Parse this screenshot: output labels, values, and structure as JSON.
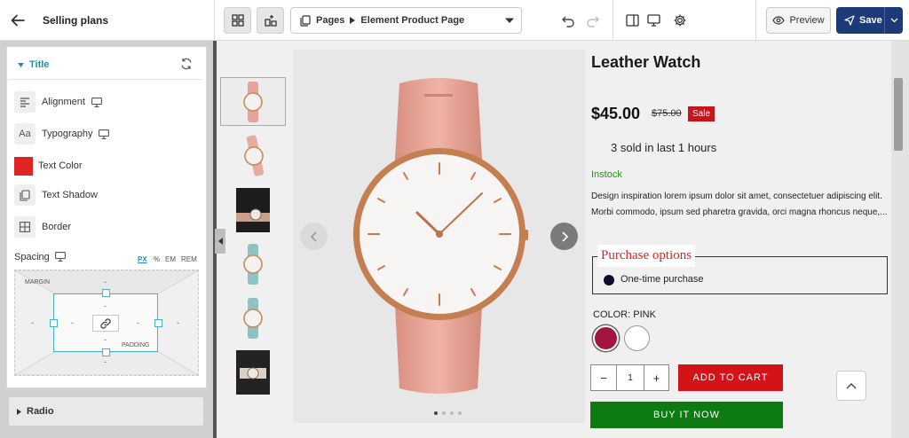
{
  "topbar": {
    "back_icon": "arrow-left-icon",
    "panel_title": "Selling plans",
    "pages_select": {
      "root": "Pages",
      "current": "Element Product Page"
    },
    "preview_label": "Preview",
    "save_label": "Save"
  },
  "settings": {
    "section_title": "Title",
    "properties": [
      {
        "label": "Alignment",
        "icon": "align-left-icon"
      },
      {
        "label": "Typography",
        "icon": "typography-icon",
        "glyph": "Aa"
      },
      {
        "label": "Text Color",
        "icon": "color-swatch",
        "color": "#e02424"
      },
      {
        "label": "Text Shadow",
        "icon": "copy-icon"
      },
      {
        "label": "Border",
        "icon": "border-grid-icon"
      }
    ],
    "spacing": {
      "label": "Spacing",
      "units": [
        "PX",
        "%",
        "EM",
        "REM"
      ],
      "active_unit": "PX",
      "margin_label": "MARGIN",
      "padding_label": "PADDING",
      "empty_value": "-"
    },
    "collapsed_section": "Radio"
  },
  "product": {
    "title": "Leather Watch",
    "price": "$45.00",
    "compare_price": "$75.00",
    "sale_badge": "Sale",
    "sold_text": "3 sold in last 1 hours",
    "stock": "Instock",
    "description": "Design inspiration lorem ipsum dolor sit amet, consectetuer adipiscing elit. Morbi commodo, ipsum sed pharetra gravida, orci magna rhoncus neque,...",
    "purchase_options_label": "Purchase options",
    "purchase_option": "One-time purchase",
    "color_label": "COLOR:",
    "color_value": "PINK",
    "swatches": [
      "#a3143e",
      "#ffffff"
    ],
    "qty_minus": "−",
    "qty_value": "1",
    "qty_plus": "+",
    "add_to_cart": "ADD TO CART",
    "buy_now": "BUY IT NOW"
  },
  "colors": {
    "accent": "#1f8fb8",
    "save_button": "#1d3a78",
    "sale": "#c4161c",
    "add_to_cart": "#d41319",
    "buy_now": "#0d7a12",
    "stock": "#2d8b1d",
    "purchase_label": "#dd2222"
  }
}
